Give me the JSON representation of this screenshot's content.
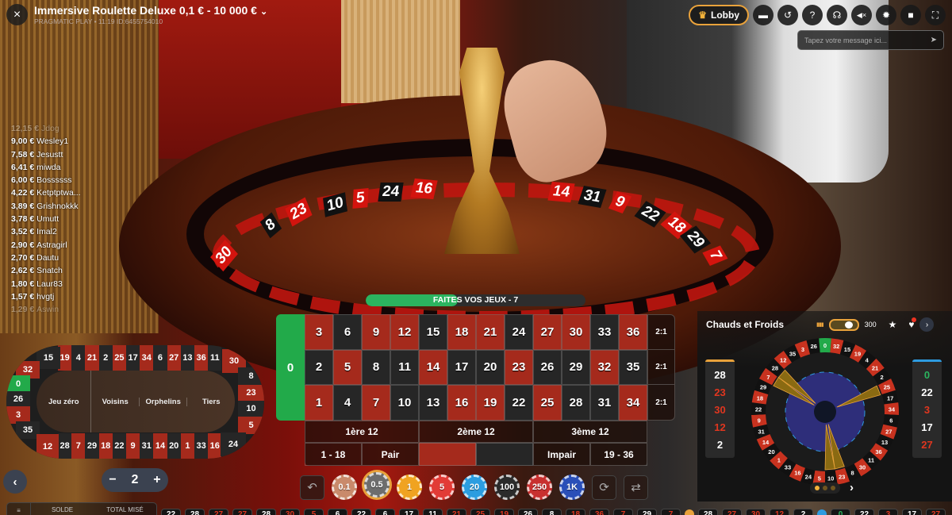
{
  "header": {
    "title": "Immersive Roulette Deluxe 0,1 € - 10 000 €",
    "subtitle": "PRAGMATIC PLAY • 11:19 ID:6455754010",
    "close_icon": "×",
    "chevron_icon": "⌄"
  },
  "toolbar": {
    "lobby_label": "Lobby",
    "crown_icon": "♛",
    "buttons": [
      {
        "name": "chat-icon",
        "glyph": "▬"
      },
      {
        "name": "history-icon",
        "glyph": "↺"
      },
      {
        "name": "help-icon",
        "glyph": "?"
      },
      {
        "name": "headset-icon",
        "glyph": "☊"
      },
      {
        "name": "mute-icon",
        "glyph": "◀×"
      },
      {
        "name": "settings-icon",
        "glyph": "✹"
      },
      {
        "name": "video-icon",
        "glyph": "■"
      },
      {
        "name": "fullscreen-icon",
        "glyph": "⛶"
      }
    ]
  },
  "chat": {
    "placeholder": "Tapez votre message ici...",
    "send_icon": "➤"
  },
  "winners": [
    {
      "amount": "12,15 €",
      "name": "Jdog"
    },
    {
      "amount": "9,00 €",
      "name": "Wesley1"
    },
    {
      "amount": "7,58 €",
      "name": "Jesustt"
    },
    {
      "amount": "6,41 €",
      "name": "miwda"
    },
    {
      "amount": "6,00 €",
      "name": "Bossssss"
    },
    {
      "amount": "4,22 €",
      "name": "Ketptptwa..."
    },
    {
      "amount": "3,89 €",
      "name": "Grishnokkk"
    },
    {
      "amount": "3,78 €",
      "name": "Umutt"
    },
    {
      "amount": "3,52 €",
      "name": "Imal2"
    },
    {
      "amount": "2,90 €",
      "name": "Astragirl"
    },
    {
      "amount": "2,70 €",
      "name": "Dautu"
    },
    {
      "amount": "2,62 €",
      "name": "Snatch"
    },
    {
      "amount": "1,80 €",
      "name": "Laur83"
    },
    {
      "amount": "1,57 €",
      "name": "hvgtj"
    },
    {
      "amount": "1,29 €",
      "name": "Aswin"
    }
  ],
  "video_wheel_numbers": [
    {
      "n": "30",
      "c": "r"
    },
    {
      "n": "8",
      "c": "b"
    },
    {
      "n": "23",
      "c": "r"
    },
    {
      "n": "10",
      "c": "b"
    },
    {
      "n": "5",
      "c": "r"
    },
    {
      "n": "24",
      "c": "b"
    },
    {
      "n": "16",
      "c": "r"
    },
    {
      "n": "14",
      "c": "r"
    },
    {
      "n": "31",
      "c": "b"
    },
    {
      "n": "9",
      "c": "r"
    },
    {
      "n": "22",
      "c": "b"
    },
    {
      "n": "18",
      "c": "r"
    },
    {
      "n": "29",
      "c": "b"
    },
    {
      "n": "7",
      "c": "r"
    }
  ],
  "racetrack": {
    "top": [
      "19",
      "4",
      "21",
      "2",
      "25",
      "17",
      "34",
      "6",
      "27",
      "13",
      "36",
      "11"
    ],
    "bottom": [
      "28",
      "7",
      "29",
      "18",
      "22",
      "9",
      "31",
      "14",
      "20",
      "1",
      "33",
      "16"
    ],
    "left": [
      "15",
      "32",
      "0",
      "26",
      "3",
      "35",
      "12"
    ],
    "right": [
      "30",
      "8",
      "23",
      "10",
      "5",
      "24"
    ],
    "sections": [
      "Jeu zéro",
      "Voisins",
      "Orphelins",
      "Tiers"
    ]
  },
  "status": {
    "text": "FAITES VOS JEUX - 7",
    "progress": 0.42
  },
  "table": {
    "zero": "0",
    "rows": [
      [
        "3",
        "6",
        "9",
        "12",
        "15",
        "18",
        "21",
        "24",
        "27",
        "30",
        "33",
        "36"
      ],
      [
        "2",
        "5",
        "8",
        "11",
        "14",
        "17",
        "20",
        "23",
        "26",
        "29",
        "32",
        "35"
      ],
      [
        "1",
        "4",
        "7",
        "10",
        "13",
        "16",
        "19",
        "22",
        "25",
        "28",
        "31",
        "34"
      ]
    ],
    "red_numbers": [
      "1",
      "3",
      "5",
      "7",
      "9",
      "12",
      "14",
      "16",
      "18",
      "19",
      "21",
      "23",
      "25",
      "27",
      "30",
      "32",
      "34",
      "36"
    ],
    "columns": [
      "2:1",
      "2:1",
      "2:1"
    ],
    "dozens": [
      "1ère 12",
      "2ème 12",
      "3ème 12"
    ],
    "outside": [
      "1 - 18",
      "Pair",
      "",
      "",
      "Impair",
      "19 - 36"
    ]
  },
  "chips": {
    "undo_icon": "↶",
    "repeat_icon": "⟳",
    "double_icon": "⇄",
    "selected": "0.5",
    "items": [
      {
        "label": "0.1",
        "color": "#c98a6b"
      },
      {
        "label": "0.5",
        "color": "#6d6d6d"
      },
      {
        "label": "1",
        "color": "#f0a321"
      },
      {
        "label": "5",
        "color": "#e23b36"
      },
      {
        "label": "20",
        "color": "#2b9de0"
      },
      {
        "label": "100",
        "color": "#2b2b2b"
      },
      {
        "label": "250",
        "color": "#c8302f"
      },
      {
        "label": "1K",
        "color": "#2a4fb8"
      }
    ]
  },
  "nav": {
    "back_icon": "‹",
    "stepper_value": "2",
    "minus": "−",
    "plus": "+"
  },
  "balance": {
    "solde_label": "SOLDE",
    "total_label": "TOTAL MISÉ",
    "menu_icon": "≡"
  },
  "history": [
    {
      "n": "22",
      "c": "b"
    },
    {
      "n": "28",
      "c": "b"
    },
    {
      "n": "27",
      "c": "r"
    },
    {
      "n": "27",
      "c": "r"
    },
    {
      "n": "28",
      "c": "b"
    },
    {
      "n": "30",
      "c": "r"
    },
    {
      "n": "5",
      "c": "r"
    },
    {
      "n": "6",
      "c": "b"
    },
    {
      "n": "22",
      "c": "b"
    },
    {
      "n": "6",
      "c": "b"
    },
    {
      "n": "17",
      "c": "b"
    },
    {
      "n": "11",
      "c": "b"
    },
    {
      "n": "21",
      "c": "r"
    },
    {
      "n": "25",
      "c": "r"
    },
    {
      "n": "19",
      "c": "r"
    },
    {
      "n": "26",
      "c": "b"
    },
    {
      "n": "8",
      "c": "b"
    },
    {
      "n": "18",
      "c": "r"
    },
    {
      "n": "36",
      "c": "r"
    },
    {
      "n": "7",
      "c": "r"
    },
    {
      "n": "29",
      "c": "b"
    },
    {
      "n": "7",
      "c": "r"
    }
  ],
  "history_hot": [
    {
      "n": "28",
      "c": "b"
    },
    {
      "n": "27",
      "c": "r"
    },
    {
      "n": "30",
      "c": "r"
    },
    {
      "n": "12",
      "c": "r"
    },
    {
      "n": "2",
      "c": "b"
    }
  ],
  "history_cold": [
    {
      "n": "0",
      "c": "g"
    },
    {
      "n": "22",
      "c": "b"
    },
    {
      "n": "3",
      "c": "r"
    },
    {
      "n": "17",
      "c": "b"
    },
    {
      "n": "27",
      "c": "r"
    }
  ],
  "hot_cold": {
    "title": "Chauds et Froids",
    "rounds": "300",
    "slider_fraction": 0.75,
    "stats_icon": "▮▮▮",
    "star_icon": "★",
    "heart_icon": "♥",
    "next_icon": "›",
    "hot": [
      {
        "n": "28",
        "c": "b"
      },
      {
        "n": "23",
        "c": "r"
      },
      {
        "n": "30",
        "c": "r"
      },
      {
        "n": "12",
        "c": "r"
      },
      {
        "n": "2",
        "c": "b"
      }
    ],
    "cold": [
      {
        "n": "0",
        "c": "g"
      },
      {
        "n": "22",
        "c": "b"
      },
      {
        "n": "3",
        "c": "r"
      },
      {
        "n": "17",
        "c": "b"
      },
      {
        "n": "27",
        "c": "r"
      }
    ],
    "wheel_order": [
      "0",
      "32",
      "15",
      "19",
      "4",
      "21",
      "2",
      "25",
      "17",
      "34",
      "6",
      "27",
      "13",
      "36",
      "11",
      "30",
      "8",
      "23",
      "10",
      "5",
      "24",
      "16",
      "33",
      "1",
      "20",
      "14",
      "31",
      "9",
      "22",
      "18",
      "29",
      "7",
      "28",
      "12",
      "35",
      "3",
      "26"
    ],
    "hot_highlight": [
      "7",
      "28",
      "25",
      "23",
      "10"
    ],
    "pager_active": 0,
    "pager_count": 3
  },
  "colors": {
    "red": "#a52a1c",
    "black": "#262626",
    "green": "#22aa4a",
    "accent": "#e9a23b",
    "cold": "#2e9be0"
  }
}
